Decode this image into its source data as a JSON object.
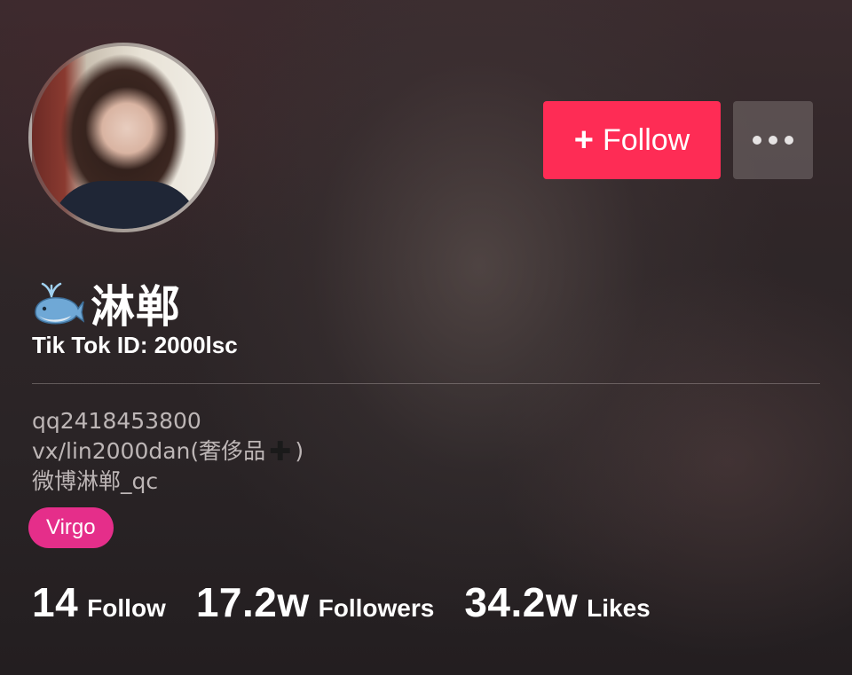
{
  "profile": {
    "nickname": "淋郸",
    "name_icon": "whale-emoji",
    "user_id": "Tik Tok ID: 2000lsc",
    "bio_lines": {
      "line1": "qq2418453800",
      "line2_prefix": "vx/lin2000dan(奢侈品",
      "line2_suffix": ")",
      "line3": "微博淋郸_qc"
    },
    "tag": "Virgo"
  },
  "actions": {
    "follow_plus": "+",
    "follow_label": "Follow",
    "more_icon": "ellipsis-icon"
  },
  "stats": {
    "following": {
      "value": "14",
      "label": "Follow"
    },
    "followers": {
      "value": "17.2w",
      "label": "Followers"
    },
    "likes": {
      "value": "34.2w",
      "label": "Likes"
    }
  },
  "colors": {
    "follow_button": "#fe2c55",
    "tag": "#e52e8a"
  }
}
